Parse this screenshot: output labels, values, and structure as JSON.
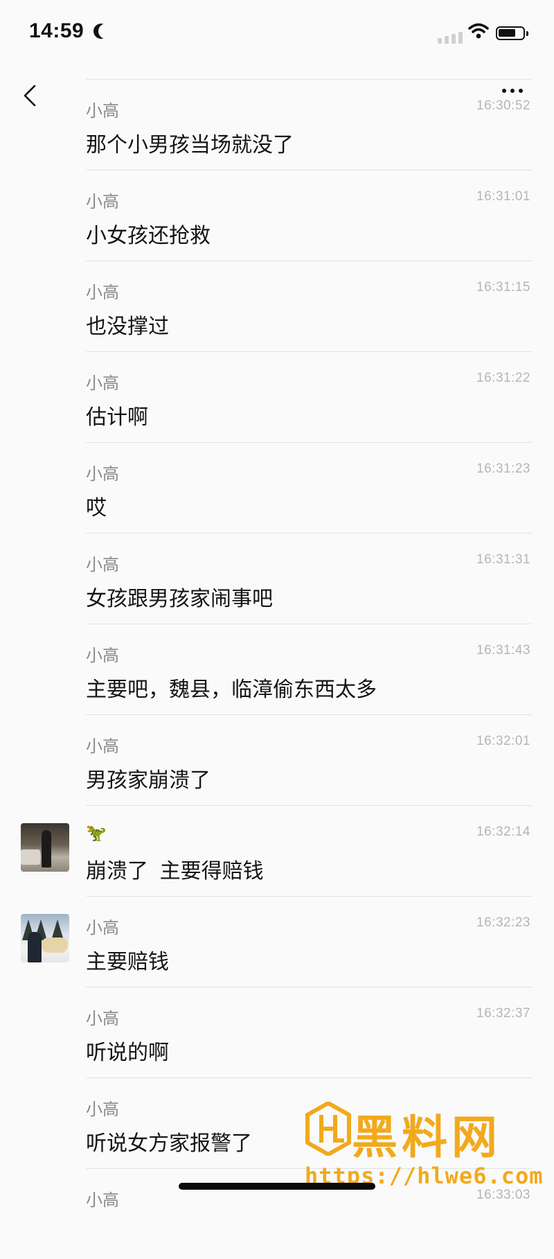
{
  "status_bar": {
    "time": "14:59"
  },
  "nav": {
    "back_icon": "chevron-left-icon",
    "more_icon": "ellipsis-icon"
  },
  "messages": [
    {
      "name": "小高",
      "time": "16:30:52",
      "text": "那个小男孩当场就没了"
    },
    {
      "name": "小高",
      "time": "16:31:01",
      "text": "小女孩还抢救"
    },
    {
      "name": "小高",
      "time": "16:31:15",
      "text": "也没撑过"
    },
    {
      "name": "小高",
      "time": "16:31:22",
      "text": "估计啊"
    },
    {
      "name": "小高",
      "time": "16:31:23",
      "text": "哎"
    },
    {
      "name": "小高",
      "time": "16:31:31",
      "text": "女孩跟男孩家闹事吧"
    },
    {
      "name": "小高",
      "time": "16:31:43",
      "text": "主要吧，魏县，临漳偷东西太多"
    },
    {
      "name": "小高",
      "time": "16:32:01",
      "text": "男孩家崩溃了"
    },
    {
      "name": "🦖",
      "time": "16:32:14",
      "text": "崩溃了  主要得赔钱"
    },
    {
      "name": "小高",
      "time": "16:32:23",
      "text": "主要赔钱"
    },
    {
      "name": "小高",
      "time": "16:32:37",
      "text": "听说的啊"
    },
    {
      "name": "小高",
      "time": "",
      "text": "听说女方家报警了"
    },
    {
      "name": "小高",
      "time": "16:33:03",
      "text": ""
    }
  ],
  "watermark": {
    "title": "黑料网",
    "url": "https://hlwe6.com"
  }
}
